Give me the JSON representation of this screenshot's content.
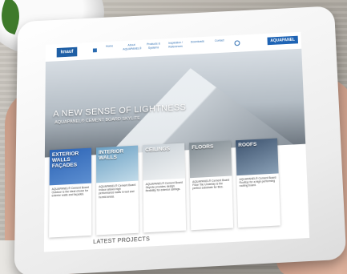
{
  "website": {
    "logo": "knauf",
    "nav": [
      "Home",
      "About AQUAPANEL®",
      "Products & Systems",
      "Inspiration / References",
      "Downloads",
      "Contact"
    ],
    "brand_button": "AQUAPANEL",
    "hero_title": "A NEW SENSE OF LIGHTNESS",
    "hero_subtitle": "AQUAPANEL® CEMENT BOARD SKYLITE",
    "cards": [
      {
        "label": "EXTERIOR WALLS FAÇADES",
        "text": "AQUAPANEL® Cement Board Outdoor is the ideal choice for exterior walls and façades.",
        "color": "#2b63b5"
      },
      {
        "label": "INTERIOR WALLS",
        "text": "AQUAPANEL® Cement Board Indoor allows high performance walls in wet and humid areas.",
        "color": "#6aa0c4"
      },
      {
        "label": "CEILINGS",
        "text": "AQUAPANEL® Cement Board SkyLite provides design flexibility for exterior ceilings.",
        "color": "#d9dde0"
      },
      {
        "label": "FLOORS",
        "text": "AQUAPANEL® Cement Board Floor Tile Underlay is the perfect substrate for tiles.",
        "color": "#9aa4ab"
      },
      {
        "label": "ROOFS",
        "text": "AQUAPANEL® Cement Board Rooftop for a high performing roofing board.",
        "color": "#556c86"
      }
    ],
    "latest_projects": "LATEST PROJECTS"
  }
}
